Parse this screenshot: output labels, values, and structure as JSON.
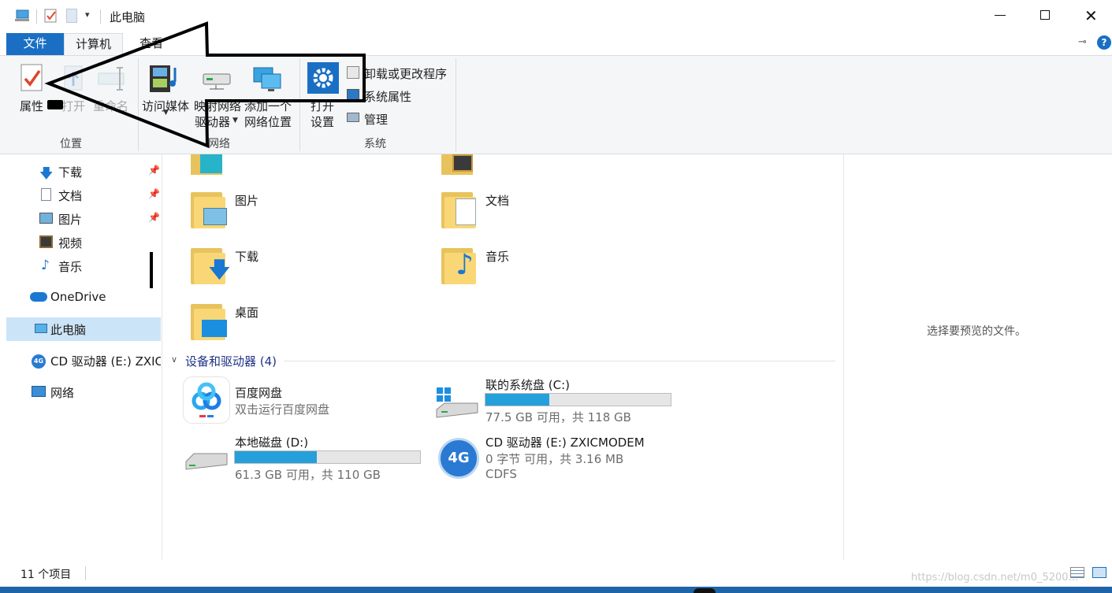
{
  "window": {
    "title": "此电脑"
  },
  "tabs": {
    "file": "文件",
    "computer": "计算机",
    "view": "查看"
  },
  "ribbon": {
    "properties": "属性",
    "open": "打开",
    "rename": "重命名",
    "location_group": "位置",
    "media_access": "访问媒体",
    "map_drive_1": "映射网络",
    "map_drive_2": "驱动器",
    "add_location_1": "添加一个",
    "add_location_2": "网络位置",
    "network_group": "网络",
    "open_settings_1": "打开",
    "open_settings_2": "设置",
    "uninstall": "卸载或更改程序",
    "sys_properties": "系统属性",
    "manage": "管理",
    "system_group": "系统"
  },
  "nav": {
    "downloads": "下载",
    "documents": "文档",
    "pictures": "图片",
    "videos": "视频",
    "music": "音乐",
    "onedrive": "OneDrive",
    "this_pc": "此电脑",
    "cd_drive": "CD 驱动器 (E:) ZXICM",
    "network": "网络"
  },
  "folders": {
    "pictures": "图片",
    "documents": "文档",
    "downloads": "下载",
    "music": "音乐",
    "desktop": "桌面"
  },
  "devices_header": "设备和驱动器 (4)",
  "devices": {
    "baidu": {
      "name": "百度网盘",
      "sub": "双击运行百度网盘"
    },
    "c": {
      "name": "联的系统盘 (C:)",
      "free": "77.5 GB 可用，共 118 GB",
      "used_fraction": 0.343
    },
    "d": {
      "name": "本地磁盘 (D:)",
      "free": "61.3 GB 可用，共 110 GB",
      "used_fraction": 0.443
    },
    "e": {
      "name": "CD 驱动器 (E:) ZXICMODEM",
      "free": "0 字节 可用，共 3.16 MB",
      "fs": "CDFS"
    }
  },
  "preview": "选择要预览的文件。",
  "status": {
    "count": "11 个项目"
  },
  "watermark": "https://blog.csdn.net/m0_5200..."
}
